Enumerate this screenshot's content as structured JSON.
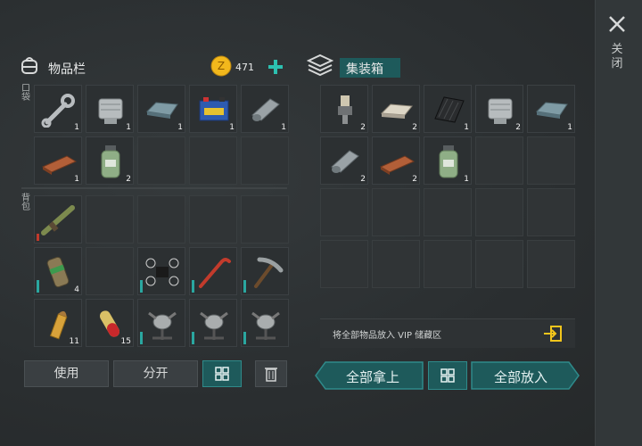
{
  "inventory": {
    "title": "物品栏",
    "coins": "471",
    "pocket_label": "口袋",
    "backpack_label": "背包",
    "pocket_slots": [
      {
        "item": "wrench",
        "count": "1"
      },
      {
        "item": "engine-part",
        "count": "1"
      },
      {
        "item": "steel-ingot",
        "count": "1"
      },
      {
        "item": "battery",
        "count": "1"
      },
      {
        "item": "metal-roll",
        "count": "1"
      },
      {
        "item": "wood-plank",
        "count": "1"
      },
      {
        "item": "glass-jar",
        "count": "2"
      },
      {
        "item": "",
        "count": ""
      },
      {
        "item": "",
        "count": ""
      },
      {
        "item": "",
        "count": ""
      }
    ],
    "backpack_slots": [
      {
        "item": "rifle",
        "count": ""
      },
      {
        "item": "",
        "count": ""
      },
      {
        "item": "",
        "count": ""
      },
      {
        "item": "",
        "count": ""
      },
      {
        "item": "",
        "count": ""
      },
      {
        "item": "grenade-canister",
        "count": "4"
      },
      {
        "item": "",
        "count": ""
      },
      {
        "item": "drone",
        "count": ""
      },
      {
        "item": "crowbar",
        "count": ""
      },
      {
        "item": "pickaxe",
        "count": ""
      },
      {
        "item": "bullet",
        "count": "11"
      },
      {
        "item": "pill-capsule",
        "count": "15"
      },
      {
        "item": "turret-bug",
        "count": ""
      },
      {
        "item": "turret-bug",
        "count": ""
      },
      {
        "item": "turret-bug",
        "count": ""
      }
    ]
  },
  "container": {
    "title": "集装箱",
    "slots": [
      {
        "item": "spark-plug",
        "count": "2"
      },
      {
        "item": "stone-block",
        "count": "2"
      },
      {
        "item": "rubber-sheet",
        "count": "1"
      },
      {
        "item": "engine-part",
        "count": "2"
      },
      {
        "item": "steel-ingot",
        "count": "1"
      },
      {
        "item": "metal-roll",
        "count": "2"
      },
      {
        "item": "wood-plank",
        "count": "2"
      },
      {
        "item": "glass-jar",
        "count": "1"
      }
    ],
    "vip_text": "将全部物品放入 VIP 储藏区"
  },
  "buttons": {
    "use": "使用",
    "split": "分开",
    "take_all": "全部拿上",
    "put_all": "全部放入",
    "close": "关闭"
  },
  "colors": {
    "teal": "#1e5a5b",
    "accent": "#2aa7a0",
    "coin": "#f2b81c"
  }
}
